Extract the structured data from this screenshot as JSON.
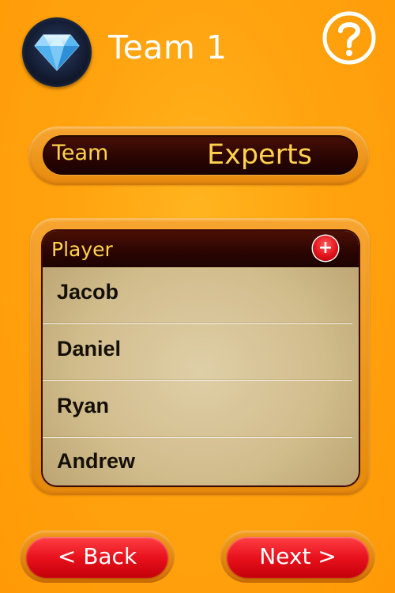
{
  "header": {
    "title": "Team 1",
    "avatar_icon": "diamond-icon",
    "help_icon": "question-mark-icon"
  },
  "team_field": {
    "label": "Team",
    "value": "Experts"
  },
  "players": {
    "header_label": "Player",
    "add_icon": "plus-icon",
    "add_label": "+",
    "items": [
      {
        "name": "Jacob"
      },
      {
        "name": "Daniel"
      },
      {
        "name": "Ryan"
      },
      {
        "name": "Andrew"
      }
    ]
  },
  "nav": {
    "back_label": "< Back",
    "next_label": "Next >"
  },
  "colors": {
    "background": "#ffa30f",
    "accent_text": "#ffd24d",
    "dark_bar": "#2a0502",
    "button_red": "#e8121d"
  }
}
